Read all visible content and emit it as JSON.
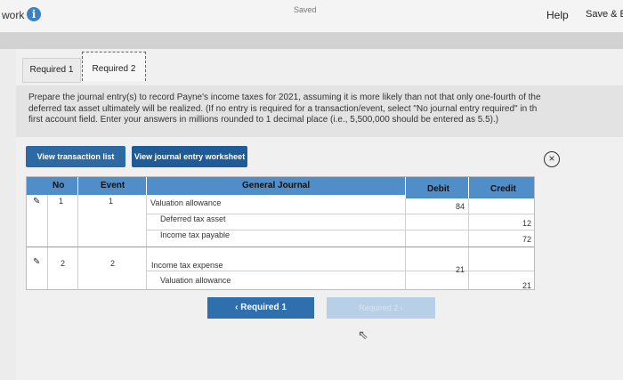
{
  "topbar": {
    "work_label": "work",
    "info_icon": "i",
    "saved_label": "Saved",
    "help_label": "Help",
    "save_label": "Save & E"
  },
  "tabs": [
    {
      "label": "Required 1"
    },
    {
      "label": "Required 2"
    }
  ],
  "instructions": {
    "line1": "Prepare the journal entry(s) to record Payne's income taxes for 2021, assuming it is more likely than not that only one-fourth of the",
    "line2": "deferred tax asset ultimately will be realized. (If no entry is required for a transaction/event, select \"No journal entry required\" in th",
    "line3": "first account field. Enter your answers in millions rounded to 1 decimal place (i.e., 5,500,000 should be entered as 5.5).)"
  },
  "buttons": {
    "view_transaction_list": "View transaction list",
    "view_journal_entry_worksheet": "View journal entry worksheet"
  },
  "journal": {
    "headers": {
      "no": "No",
      "event": "Event",
      "general_journal": "General Journal",
      "debit": "Debit",
      "credit": "Credit"
    },
    "entries": [
      {
        "no": "1",
        "event": "1",
        "lines": [
          {
            "account": "Valuation allowance",
            "debit": "84",
            "credit": ""
          },
          {
            "account": "Deferred tax asset",
            "debit": "",
            "credit": "12"
          },
          {
            "account": "Income tax payable",
            "debit": "",
            "credit": "72"
          }
        ]
      },
      {
        "no": "2",
        "event": "2",
        "lines": [
          {
            "account": "Income tax expense",
            "debit": "21",
            "credit": ""
          },
          {
            "account": "Valuation allowance",
            "debit": "",
            "credit": "21"
          }
        ]
      }
    ]
  },
  "navigation": {
    "prev_label": "Required 1",
    "next_label": "Required 2"
  },
  "icons": {
    "info": "info-icon",
    "close": "close-icon",
    "pencil": "pencil-icon",
    "prev": "chevron-left-icon",
    "next": "chevron-right-icon",
    "cursor": "cursor-icon"
  }
}
